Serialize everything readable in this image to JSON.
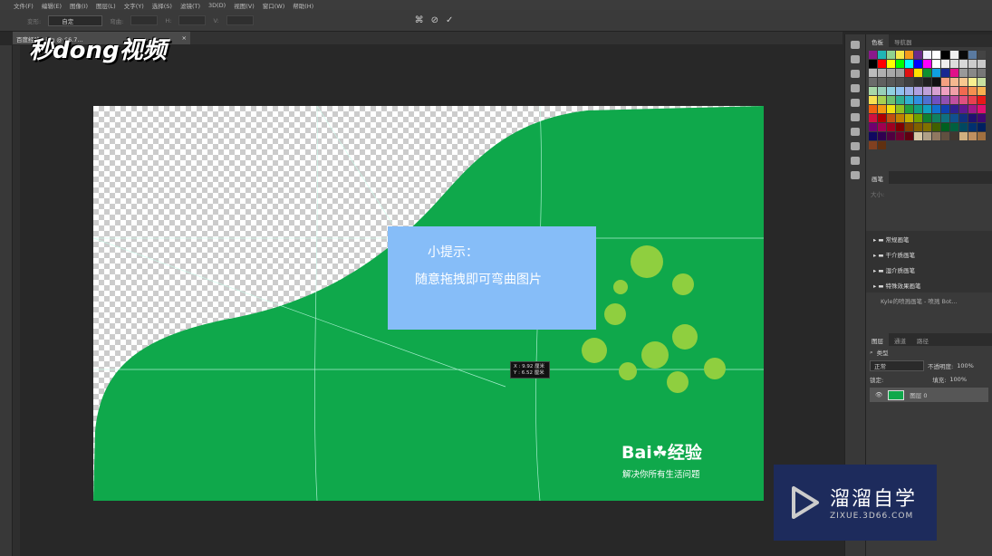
{
  "menu": [
    "文件(F)",
    "编辑(E)",
    "图像(I)",
    "图层(L)",
    "文字(Y)",
    "选择(S)",
    "滤镜(T)",
    "3D(D)",
    "视图(V)",
    "窗口(W)",
    "帮助(H)"
  ],
  "options": {
    "warp_label": "变形:",
    "warp_value": "自定",
    "bend_label": "弯曲:",
    "h_label": "H:",
    "v_label": "V:"
  },
  "document_tab": {
    "title": "百度经验...jpg @ 66.7...",
    "close": "×"
  },
  "watermark": "秒dong视频",
  "canvas": {
    "tip_title": "小提示：",
    "tip_text": "随意拖拽即可弯曲图片",
    "coord_x": "X : 9.92 厘米",
    "coord_y": "Y : 6.52 厘米",
    "baidu_logo": "Bai☘经验",
    "baidu_slogan": "解决你所有生活问题",
    "green": "#0fa84b"
  },
  "panels": {
    "swatch_tabs": [
      "色板",
      "导航器"
    ],
    "swatches": [
      "#8b1a8b",
      "#1fb5b5",
      "#8fd28f",
      "#f5e84a",
      "#f59b1a",
      "#6a2a8a",
      "#f0f0ff",
      "#ffffff",
      "#000000",
      "#f0f0f0",
      "#0a0a0a",
      "#5a7aa0",
      "#444444",
      "#000000",
      "#ff0000",
      "#ffff00",
      "#00ff00",
      "#00ffff",
      "#0000ff",
      "#ff00ff",
      "#ffffff",
      "#eeeeee",
      "#dddddd",
      "#d8d8d8",
      "#cccccc",
      "#c8c8c8",
      "#bbbbbb",
      "#b0b0b0",
      "#a8a8a8",
      "#a0a0a0",
      "#e01010",
      "#ffe000",
      "#109030",
      "#10a0e0",
      "#182890",
      "#e0108a",
      "#999999",
      "#888888",
      "#777777",
      "#6a6a6a",
      "#606060",
      "#585858",
      "#505050",
      "#404040",
      "#303030",
      "#202020",
      "#101010",
      "#f4a080",
      "#f4b890",
      "#f8c890",
      "#f8f090",
      "#c8e0a0",
      "#a8d8a8",
      "#98d0b8",
      "#90d0e0",
      "#90c0f0",
      "#a0b0e8",
      "#b0a0e0",
      "#c0a0d8",
      "#d8a0d0",
      "#f0a0c0",
      "#f0a0a8",
      "#f06a50",
      "#f49050",
      "#f8b050",
      "#f8e050",
      "#a8d050",
      "#70c070",
      "#30b090",
      "#30b0d0",
      "#3090e0",
      "#5070d0",
      "#7050c0",
      "#9050b0",
      "#c050a0",
      "#e05080",
      "#e84050",
      "#e81818",
      "#f06010",
      "#f49810",
      "#f0e010",
      "#90c020",
      "#20a040",
      "#10a080",
      "#10a0c0",
      "#1070d0",
      "#1040b0",
      "#302090",
      "#601890",
      "#a01888",
      "#e01070",
      "#d01040",
      "#b00000",
      "#c05010",
      "#c08000",
      "#c0b000",
      "#70a000",
      "#108030",
      "#108060",
      "#107080",
      "#105090",
      "#103080",
      "#201070",
      "#400870",
      "#700070",
      "#a00050",
      "#a00020",
      "#800000",
      "#804000",
      "#806000",
      "#807000",
      "#406000",
      "#006020",
      "#006040",
      "#004860",
      "#003070",
      "#002060",
      "#100860",
      "#300050",
      "#500040",
      "#700030",
      "#600010",
      "#d8c8a8",
      "#b0a088",
      "#907860",
      "#605040",
      "#403830",
      "#d0b080",
      "#c09060",
      "#a07040",
      "#804020",
      "#603010"
    ],
    "brush_tab": "画笔",
    "brush_size_label": "大小:",
    "brush_groups": [
      "常规画笔",
      "干介质画笔",
      "湿介质画笔",
      "特殊效果画笔"
    ],
    "brush_item": "Kyle的喷溅画笔 - 喷溅 Bot...",
    "layer_tabs": [
      "图层",
      "通道",
      "路径"
    ],
    "filter_kind": "类型",
    "blend_mode": "正常",
    "opacity_label": "不透明度:",
    "opacity": "100%",
    "lock_label": "锁定:",
    "fill_label": "填充:",
    "fill": "100%",
    "layer_name": "图层 0"
  },
  "zixue": {
    "name": "溜溜自学",
    "url": "ZIXUE.3D66.COM"
  }
}
